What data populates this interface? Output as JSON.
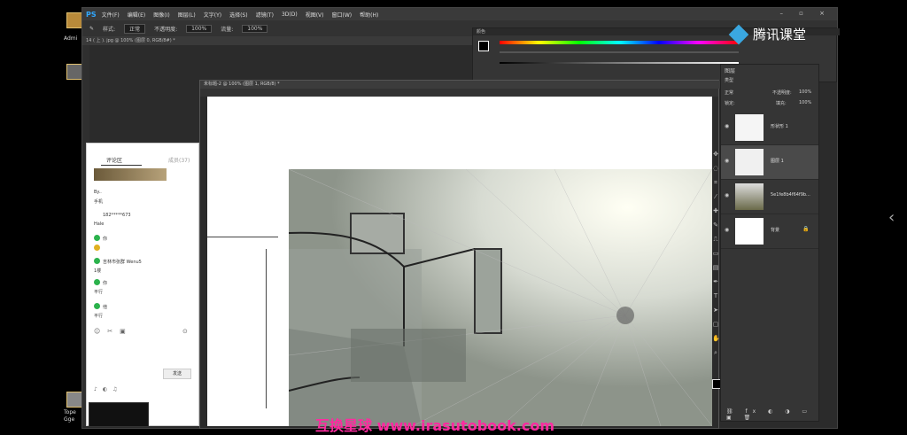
{
  "desktop": {
    "icon_labels": [
      "Admi",
      "Tope",
      "Gge"
    ]
  },
  "photoshop": {
    "logo": "PS",
    "menu": [
      "文件(F)",
      "编辑(E)",
      "图像(I)",
      "图层(L)",
      "文字(Y)",
      "选择(S)",
      "滤镜(T)",
      "3D(D)",
      "视图(V)",
      "窗口(W)",
      "帮助(H)"
    ],
    "options": {
      "style_label": "样式:",
      "style_value": "正常",
      "opacity_label": "不透明度:",
      "opacity_value": "100%",
      "flow_label": "流量:",
      "flow_value": "100%"
    },
    "doc1_tab": "14 ( 上 ). jpg @ 100% (图层 0, RGB/8#) *",
    "doc2_tab": "未标题-2 @ 100% (图层 1, RGB/8) *",
    "color_panel_title": "颜色",
    "layers": {
      "title": "图层",
      "kind": "类型",
      "blend_mode": "正常",
      "opacity_label": "不透明度:",
      "opacity_value": "100%",
      "lock_label": "锁定:",
      "fill_label": "填充:",
      "fill_value": "100%",
      "items": [
        {
          "name": "形状形 1"
        },
        {
          "name": "图层 1"
        },
        {
          "name": "5e1fe8b4f64f9b..."
        },
        {
          "name": "背景"
        }
      ]
    }
  },
  "chat": {
    "tab_active": "评论区",
    "tab_other": "成员(37)",
    "lines": [
      "By..",
      "手机",
      "182*****673",
      "Hale",
      "你",
      "",
      "吉林市张群 Wenu5",
      "1楼",
      "你",
      "平行",
      "他",
      "平行"
    ],
    "send_label": "发送"
  },
  "branding": {
    "tencent": "腾讯课堂",
    "watermark": "互换星球 www.irasutobook.com"
  },
  "colors": {
    "watermark": "#ff2aa0",
    "ps_blue": "#31a8ff",
    "tencent_blue": "#3aa7e0"
  }
}
